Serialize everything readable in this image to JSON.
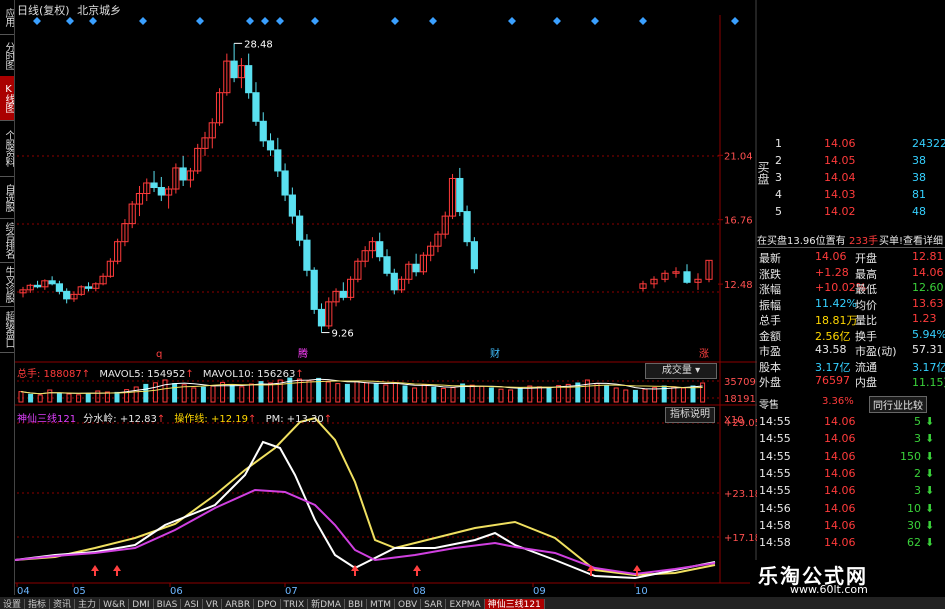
{
  "header": {
    "period": "日线(复权)",
    "stock_name": "北京城乡"
  },
  "sidebar": [
    {
      "label": "应用",
      "active": false
    },
    {
      "label": "分时图",
      "active": false
    },
    {
      "label": "K线图",
      "active": true
    },
    {
      "label": "个股资料",
      "active": false
    },
    {
      "label": "自选股",
      "active": false
    },
    {
      "label": "综合排名",
      "active": false
    },
    {
      "label": "牛叉诊股",
      "active": false
    },
    {
      "label": "超级盘口",
      "active": false
    }
  ],
  "price_panel": {
    "y_ticks": [
      "21.04",
      "16.76",
      "12.48"
    ],
    "high_label": "28.48",
    "low_label": "9.26",
    "markers": [
      "q",
      "腾",
      "财",
      "涨"
    ]
  },
  "volume_panel": {
    "legend": {
      "total_label": "总手: 188087",
      "mavol5": "MAVOL5: 154952",
      "mavol10": "MAVOL10: 156263"
    },
    "selector_label": "成交量",
    "y_ticks": [
      "35709",
      "18191"
    ],
    "unit": "X10"
  },
  "indicator_panel": {
    "legend": {
      "name": "神仙三线121",
      "a": "分水岭: +12.83",
      "b": "操作线: +12.19",
      "c": "PM: +13.30"
    },
    "help_button": "指标说明",
    "y_ticks": [
      "+29.05",
      "+23.18",
      "+17.18"
    ]
  },
  "x_axis": {
    "labels": [
      "04",
      "05",
      "06",
      "07",
      "08",
      "09",
      "10"
    ]
  },
  "order_book": {
    "asks": [
      {
        "level": "1",
        "price": "14.06",
        "vol": "24322"
      },
      {
        "level": "2",
        "price": "14.05",
        "vol": "38"
      },
      {
        "level": "3",
        "price": "14.04",
        "vol": "38"
      },
      {
        "level": "4",
        "price": "14.03",
        "vol": "81"
      },
      {
        "level": "5",
        "price": "14.02",
        "vol": "48"
      }
    ],
    "side_label": "买盘",
    "bid_info": "在买盘13.96位置有",
    "bid_qty": "233手",
    "bid_link": "买单!查看详细"
  },
  "quote": [
    {
      "l1": "最新",
      "v1": "14.06",
      "l2": "开盘",
      "v2": "12.81",
      "c1": "red",
      "c2": "red"
    },
    {
      "l1": "涨跌",
      "v1": "+1.28",
      "l2": "最高",
      "v2": "14.06",
      "c1": "red",
      "c2": "red"
    },
    {
      "l1": "涨幅",
      "v1": "+10.02%",
      "l2": "最低",
      "v2": "12.60",
      "c1": "red",
      "c2": "green"
    },
    {
      "l1": "振幅",
      "v1": "11.42%",
      "l2": "均价",
      "v2": "13.63",
      "c1": "cyan",
      "c2": "red"
    },
    {
      "l1": "总手",
      "v1": "18.81万",
      "l2": "量比",
      "v2": "1.23",
      "c1": "yellow",
      "c2": "red"
    },
    {
      "l1": "金额",
      "v1": "2.56亿",
      "l2": "换手",
      "v2": "5.94%",
      "c1": "yellow",
      "c2": "cyan"
    },
    {
      "l1": "市盈",
      "v1": "43.58",
      "l2": "市盈(动)",
      "v2": "57.31",
      "c1": "white",
      "c2": "white"
    },
    {
      "l1": "股本",
      "v1": "3.17亿",
      "l2": "流通",
      "v2": "3.17亿",
      "c1": "cyan",
      "c2": "cyan"
    },
    {
      "l1": "外盘",
      "v1": "76597",
      "l2": "内盘",
      "v2": "11.15万",
      "c1": "red",
      "c2": "green"
    }
  ],
  "industry": {
    "label": "零售",
    "pct": "3.36%",
    "button": "同行业比较"
  },
  "ticks": [
    {
      "time": "14:55",
      "price": "14.06",
      "vol": "5",
      "dir": "down"
    },
    {
      "time": "14:55",
      "price": "14.06",
      "vol": "3",
      "dir": "down"
    },
    {
      "time": "14:55",
      "price": "14.06",
      "vol": "150",
      "dir": "down"
    },
    {
      "time": "14:55",
      "price": "14.06",
      "vol": "2",
      "dir": "down"
    },
    {
      "time": "14:55",
      "price": "14.06",
      "vol": "3",
      "dir": "down"
    },
    {
      "time": "14:56",
      "price": "14.06",
      "vol": "10",
      "dir": "down"
    },
    {
      "time": "14:58",
      "price": "14.06",
      "vol": "30",
      "dir": "down"
    },
    {
      "time": "14:58",
      "price": "14.06",
      "vol": "62",
      "dir": "down"
    }
  ],
  "bottom_tabs": [
    "设置",
    "指标",
    "资讯",
    "主力",
    "W&R",
    "DMI",
    "BIAS",
    "ASI",
    "VR",
    "ARBR",
    "DPO",
    "TRIX",
    "新DMA",
    "BBI",
    "MTM",
    "OBV",
    "SAR",
    "EXPMA",
    "神仙三线121"
  ],
  "watermark": {
    "title": "乐淘公式网",
    "url": "www.60lt.com"
  },
  "colors": {
    "up": "#ff3b3b",
    "down": "#5ae0f0",
    "ma_white": "#ffffff",
    "ma_yellow": "#f0e060",
    "ma_magenta": "#d040e0",
    "grid_red": "#8b0000"
  },
  "series": {
    "candles": [
      [
        11.9,
        12.3,
        11.6,
        12.1
      ],
      [
        12.1,
        12.5,
        11.9,
        12.4
      ],
      [
        12.4,
        12.7,
        12.2,
        12.3
      ],
      [
        12.3,
        12.8,
        12.1,
        12.7
      ],
      [
        12.7,
        13.0,
        12.4,
        12.5
      ],
      [
        12.5,
        12.7,
        11.8,
        12.0
      ],
      [
        12.0,
        12.2,
        11.2,
        11.5
      ],
      [
        11.5,
        12.0,
        11.3,
        11.8
      ],
      [
        11.8,
        12.4,
        11.7,
        12.3
      ],
      [
        12.3,
        12.6,
        12.0,
        12.2
      ],
      [
        12.2,
        12.6,
        12.0,
        12.5
      ],
      [
        12.5,
        13.2,
        12.4,
        13.0
      ],
      [
        13.0,
        14.2,
        12.9,
        14.0
      ],
      [
        14.0,
        15.5,
        13.8,
        15.3
      ],
      [
        15.3,
        16.8,
        15.0,
        16.5
      ],
      [
        16.5,
        18.0,
        16.2,
        17.8
      ],
      [
        17.8,
        19.0,
        17.0,
        18.5
      ],
      [
        18.5,
        19.5,
        18.0,
        19.2
      ],
      [
        19.2,
        20.0,
        18.6,
        18.9
      ],
      [
        18.9,
        19.6,
        18.0,
        18.4
      ],
      [
        18.4,
        19.0,
        17.5,
        18.8
      ],
      [
        18.8,
        20.5,
        18.5,
        20.2
      ],
      [
        20.2,
        21.0,
        19.0,
        19.4
      ],
      [
        19.4,
        20.2,
        18.9,
        20.0
      ],
      [
        20.0,
        21.8,
        19.8,
        21.5
      ],
      [
        21.5,
        22.6,
        21.0,
        22.2
      ],
      [
        22.2,
        23.5,
        21.5,
        23.2
      ],
      [
        23.2,
        25.5,
        23.0,
        25.2
      ],
      [
        25.2,
        27.8,
        25.0,
        27.3
      ],
      [
        27.3,
        28.48,
        25.9,
        26.2
      ],
      [
        26.2,
        27.5,
        25.5,
        27.0
      ],
      [
        27.0,
        27.8,
        24.8,
        25.2
      ],
      [
        25.2,
        25.9,
        23.0,
        23.3
      ],
      [
        23.3,
        23.9,
        21.6,
        22.0
      ],
      [
        22.0,
        22.5,
        21.0,
        21.4
      ],
      [
        21.4,
        22.2,
        19.6,
        20.0
      ],
      [
        20.0,
        20.5,
        18.0,
        18.4
      ],
      [
        18.4,
        18.9,
        16.5,
        17.0
      ],
      [
        17.0,
        17.4,
        15.0,
        15.4
      ],
      [
        15.4,
        15.8,
        13.0,
        13.4
      ],
      [
        13.4,
        13.6,
        10.5,
        10.8
      ],
      [
        10.8,
        11.2,
        9.26,
        9.7
      ],
      [
        9.7,
        11.6,
        9.5,
        11.3
      ],
      [
        11.3,
        12.2,
        11.0,
        12.0
      ],
      [
        12.0,
        12.6,
        11.4,
        11.6
      ],
      [
        11.6,
        13.0,
        11.4,
        12.8
      ],
      [
        12.8,
        14.2,
        12.6,
        14.0
      ],
      [
        14.0,
        15.0,
        13.6,
        14.7
      ],
      [
        14.7,
        15.6,
        14.2,
        15.3
      ],
      [
        15.3,
        15.9,
        14.0,
        14.3
      ],
      [
        14.3,
        14.8,
        13.0,
        13.2
      ],
      [
        13.2,
        13.5,
        11.8,
        12.1
      ],
      [
        12.1,
        13.0,
        11.9,
        12.8
      ],
      [
        12.8,
        14.0,
        12.5,
        13.8
      ],
      [
        13.8,
        14.5,
        13.0,
        13.3
      ],
      [
        13.3,
        14.6,
        13.1,
        14.4
      ],
      [
        14.4,
        15.3,
        14.0,
        15.0
      ],
      [
        15.0,
        16.0,
        14.6,
        15.8
      ],
      [
        15.8,
        17.3,
        15.5,
        17.0
      ],
      [
        17.0,
        19.8,
        16.8,
        19.5
      ],
      [
        19.5,
        20.2,
        17.0,
        17.3
      ],
      [
        17.3,
        17.7,
        15.0,
        15.3
      ],
      [
        15.3,
        15.6,
        13.2,
        13.5
      ]
    ],
    "candles_tail": [
      [
        12.2,
        12.7,
        12.0,
        12.5
      ],
      [
        12.5,
        13.0,
        12.2,
        12.8
      ],
      [
        12.8,
        13.4,
        12.6,
        13.2
      ],
      [
        13.2,
        13.6,
        12.9,
        13.3
      ],
      [
        13.3,
        13.8,
        12.5,
        12.6
      ],
      [
        12.6,
        13.2,
        12.1,
        12.8
      ],
      [
        12.8,
        14.06,
        12.6,
        14.06
      ]
    ],
    "volume": [
      52,
      38,
      35,
      60,
      44,
      40,
      36,
      42,
      55,
      50,
      48,
      62,
      75,
      88,
      96,
      110,
      92,
      86,
      70,
      74,
      80,
      98,
      84,
      76,
      90,
      102,
      95,
      110,
      120,
      115,
      108,
      118,
      100,
      92,
      88,
      104,
      96,
      90,
      85,
      94,
      80,
      70,
      86,
      74,
      68,
      72,
      90,
      84,
      78,
      70,
      64,
      60,
      72,
      80,
      76,
      70,
      82,
      88,
      95,
      110,
      92,
      80,
      70,
      60,
      58,
      64,
      72,
      80,
      76,
      70,
      80,
      95
    ]
  }
}
